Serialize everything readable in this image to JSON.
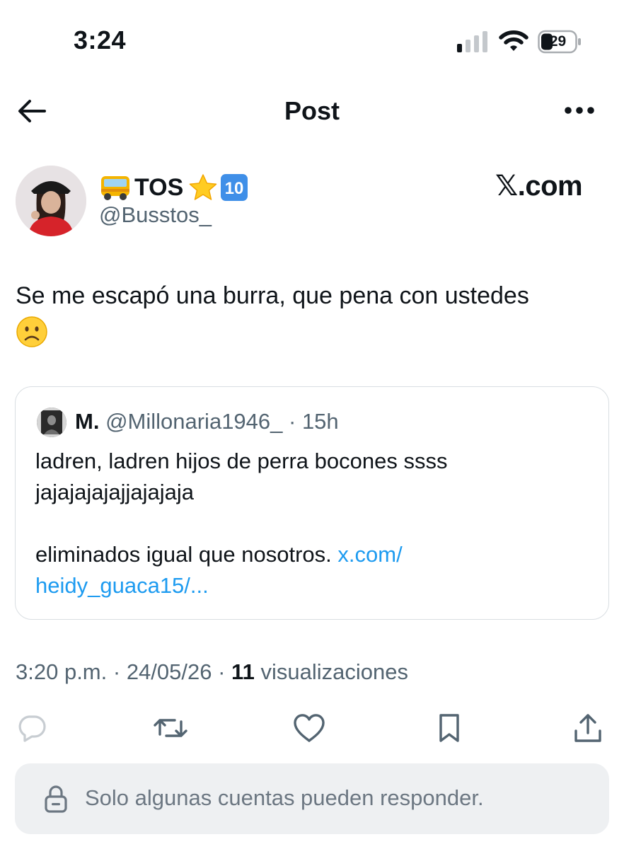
{
  "status_bar": {
    "time": "3:24",
    "battery": "29",
    "icons": [
      "signal-icon",
      "wifi-icon",
      "battery-icon"
    ]
  },
  "header": {
    "title": "Post",
    "back_icon": "back-arrow-icon",
    "more_icon": "more-dots-icon"
  },
  "author": {
    "display_name": "TOS",
    "name_emojis": [
      "bus-emoji",
      "star-emoji",
      "keycap-ten-emoji"
    ],
    "handle": "@Busstos_"
  },
  "brand": {
    "mark": "𝕏.com"
  },
  "tweet": {
    "text": "Se me escapó una burra, que pena con ustedes",
    "trailing_emoji": "frowning-face-emoji"
  },
  "quote": {
    "name": "M.",
    "handle_time": "@Millonaria1946_ · 15h",
    "line1": "ladren, ladren hijos de perra bocones ssss",
    "line2": "jajajajajajjajajaja",
    "line3": "eliminados igual que nosotros.",
    "link1": "x.com/",
    "link2": "heidy_guaca15/..."
  },
  "meta": {
    "time": "3:20 p.m.",
    "sep1": " · ",
    "date": "24/05/26",
    "sep2": " · ",
    "views_count": "11",
    "views_label": "visualizaciones"
  },
  "actions": [
    "reply-icon",
    "repost-icon",
    "like-icon",
    "bookmark-icon",
    "share-icon"
  ],
  "reply_restriction": {
    "text": "Solo algunas cuentas pueden responder."
  },
  "colors": {
    "text": "#0f1419",
    "secondary": "#536471",
    "link": "#1d9bf0",
    "border": "#d9dee2",
    "reply_bar_bg": "#eef0f2"
  }
}
